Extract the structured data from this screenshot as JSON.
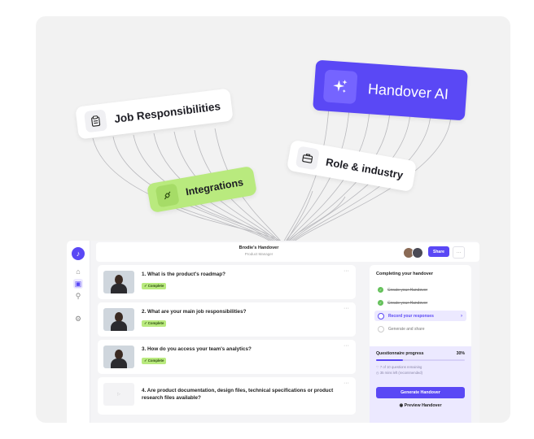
{
  "cards": {
    "job": {
      "label": "Job Responsibilities",
      "icon": "clipboard-icon"
    },
    "integrations": {
      "label": "Integrations",
      "icon": "plug-icon"
    },
    "role": {
      "label": "Role & industry",
      "icon": "briefcase-icon"
    },
    "ai": {
      "label": "Handover AI",
      "icon": "sparkles-icon"
    }
  },
  "header": {
    "title": "Brodie's Handover",
    "subtitle": "Product Manager",
    "share_label": "Share",
    "more_label": "···"
  },
  "questions": [
    {
      "number_text": "1. What is the product's roadmap?",
      "badge": "✓ Complete",
      "has_video": true
    },
    {
      "number_text": "2. What are your main job responsibilities?",
      "badge": "✓ Complete",
      "has_video": true
    },
    {
      "number_text": "3. How do you access your team's analytics?",
      "badge": "✓ Complete",
      "has_video": true
    },
    {
      "number_text": "4. Are product documentation, design files, technical specifications or product research files available?",
      "badge": "",
      "has_video": false
    }
  ],
  "sidebar": {
    "title": "Completing your handover",
    "steps": [
      {
        "label": "Create your Handover",
        "state": "done"
      },
      {
        "label": "Create your Handover",
        "state": "done"
      },
      {
        "label": "Record your responses",
        "state": "current"
      },
      {
        "label": "Generate and share",
        "state": "todo"
      }
    ],
    "progress": {
      "title": "Questionnaire progress",
      "percent_label": "30%",
      "percent": 30,
      "line1": "7 of 10 questions remaining",
      "line2": "35 mins left (recommended)",
      "generate_label": "Generate Handover",
      "preview_label": "Preview Handover"
    }
  },
  "colors": {
    "accent": "#5a48f5",
    "complete_green": "#b9ea7e",
    "background": "#f2f2f2"
  }
}
